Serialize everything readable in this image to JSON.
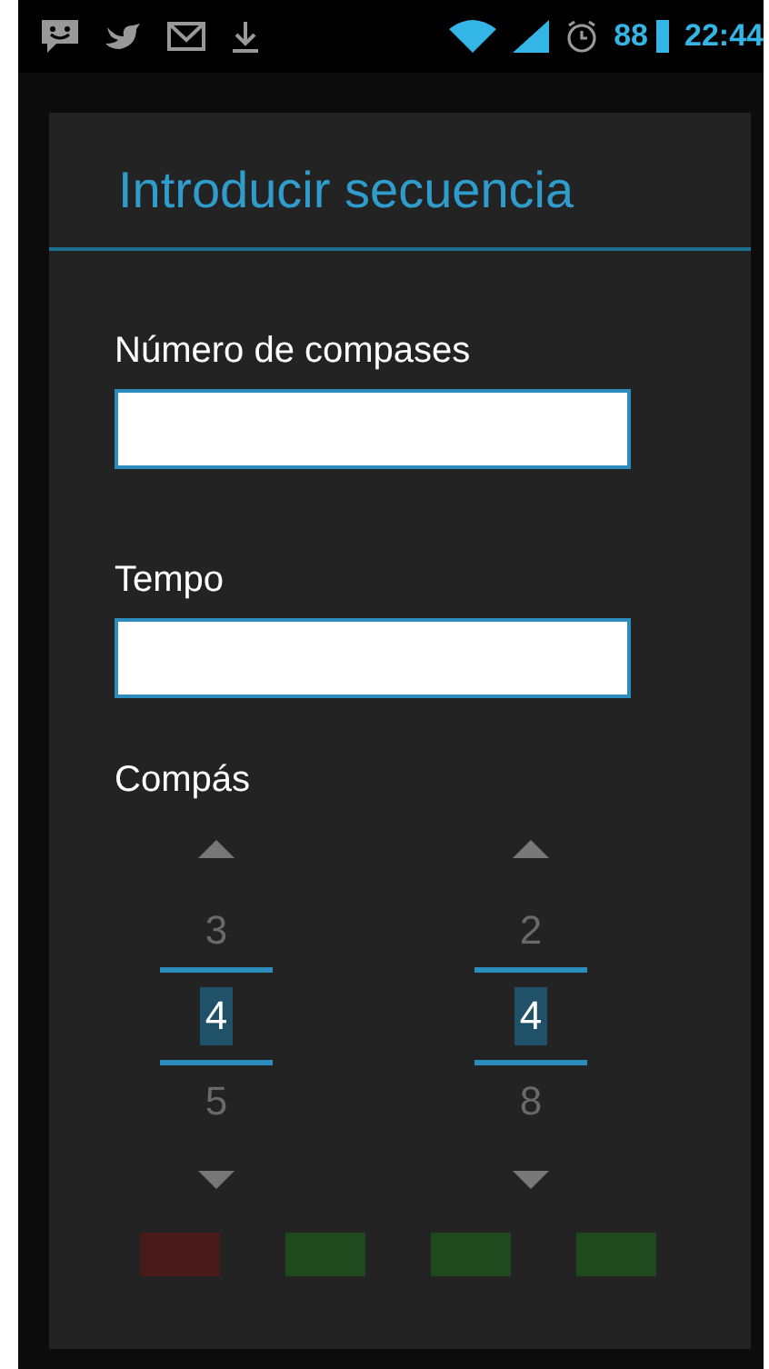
{
  "status_bar": {
    "battery": "88",
    "time": "22:44"
  },
  "dialog": {
    "title": "Introducir secuencia",
    "fields": [
      {
        "label": "Número de compases"
      },
      {
        "label": "Tempo"
      }
    ],
    "meter": {
      "label": "Compás",
      "pickers": [
        {
          "previous": "3",
          "value": "4",
          "next": "5"
        },
        {
          "previous": "2",
          "value": "4",
          "next": "8"
        }
      ]
    },
    "beats": [
      {
        "color": "#4a1a1a"
      },
      {
        "color": "#1e4a1e"
      },
      {
        "color": "#1e4a1e"
      },
      {
        "color": "#1e4a1e"
      }
    ]
  }
}
